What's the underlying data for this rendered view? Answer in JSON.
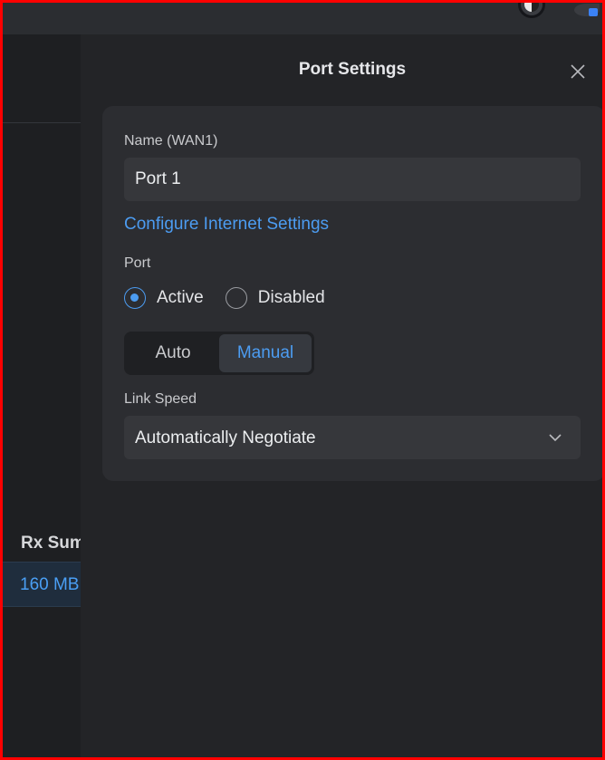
{
  "background_table": {
    "column_header": "Rx Sum",
    "selected_row_value": "160 MB"
  },
  "drawer": {
    "title": "Port Settings",
    "name_label": "Name (WAN1)",
    "name_value": "Port 1",
    "configure_link": "Configure Internet Settings",
    "port_label": "Port",
    "port_options": [
      {
        "label": "Active",
        "checked": true
      },
      {
        "label": "Disabled",
        "checked": false
      }
    ],
    "mode_options": [
      {
        "label": "Auto",
        "active": false
      },
      {
        "label": "Manual",
        "active": true
      }
    ],
    "link_speed_label": "Link Speed",
    "link_speed_value": "Automatically Negotiate"
  },
  "icons": {
    "close": "close-icon",
    "dropdown": "chevron-down-icon",
    "theme": "theme-toggle-icon"
  },
  "colors": {
    "accent": "#4c9cf1",
    "panel": "#2c2d31",
    "background": "#1e1f22"
  }
}
